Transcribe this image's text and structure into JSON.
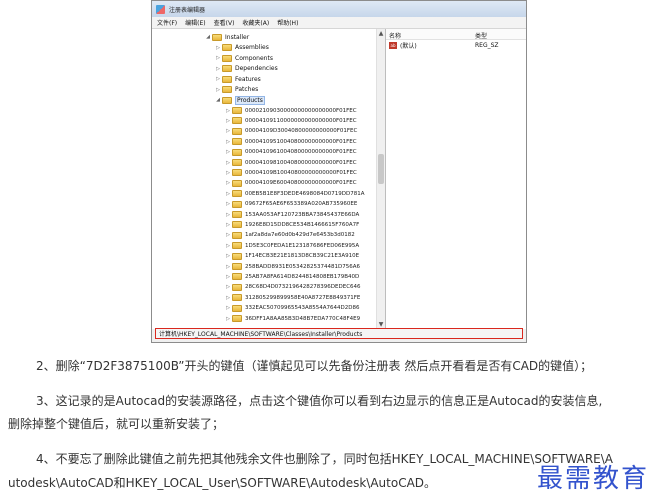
{
  "window": {
    "title": "注册表编辑器"
  },
  "menu": [
    "文件(F)",
    "编辑(E)",
    "查看(V)",
    "收藏夹(A)",
    "帮助(H)"
  ],
  "tree": {
    "items": [
      {
        "label": "Installer",
        "toggle": "◢",
        "selected": false
      },
      {
        "label": "Assemblies",
        "toggle": "▷",
        "selected": false
      },
      {
        "label": "Components",
        "toggle": "▷",
        "selected": false
      },
      {
        "label": "Dependencies",
        "toggle": "▷",
        "selected": false
      },
      {
        "label": "Features",
        "toggle": "▷",
        "selected": false
      },
      {
        "label": "Patches",
        "toggle": "▷",
        "selected": false
      },
      {
        "label": "Products",
        "toggle": "◢",
        "selected": true
      }
    ],
    "product_keys": [
      "00002109030000000000000000F01FEC",
      "00004109110000000000000000F01FEC",
      "00004109D30040800000000000F01FEC",
      "00004109510040800000000000F01FEC",
      "00004109610040800000000000F01FEC",
      "00004109810040800000000000F01FEC",
      "00004109B10040800000000000F01FEC",
      "00004109E60040800000000000F01FEC",
      "00EB5B1E8F3DEDE4698084D0719DD781A",
      "09672F65AE6F653389A020AB735960EE",
      "153AA053AF120723BBA73845437E66DA",
      "1926E8D15DD8CE534B1466615F760A7F",
      "1af2a8da7e60d0b429d7e6453b3d0182",
      "1D5E3C0FEDA1E123187686FED06E995A",
      "1F14ECB3E21E1813D8CB39C21E3A910E",
      "258BADD8931E05342825374481D756A6",
      "25AB7A8FA614D8244814808EB179B40D",
      "28C68D4D0732196428278396DEDEC646",
      "312805299899958E40A8727E8849371FE",
      "332EAC50709965543A8554A7644D2D86",
      "36DFF1A8AA85B3D48B7EDA770C48F4E9"
    ]
  },
  "values": {
    "col_name": "名称",
    "col_type": "类型",
    "rows": [
      {
        "name": "(默认)",
        "type": "REG_SZ",
        "icon": "string-value-icon"
      }
    ]
  },
  "statusbar": {
    "path": "计算机\\HKEY_LOCAL_MACHINE\\SOFTWARE\\Classes\\Installer\\Products"
  },
  "article": {
    "step2": "2、删除“7D2F3875100B”开头的键值（谨慎起见可以先备份注册表 然后点开看看是否有CAD的键值）；",
    "step3a": "3、这记录的是Autocad的安装源路径，点击这个键值你可以看到右边显示的信息正是Autocad的安装信息,",
    "step3b": "删除掉整个键值后，就可以重新安装了；",
    "step4a": "4、不要忘了删除此键值之前先把其他残余文件也删除了，同时包括HKEY_LOCAL_MACHINE\\SOFTWARE\\A",
    "step4b": "utodesk\\AutoCAD和HKEY_LOCAL_User\\SOFTWARE\\Autodesk\\AutoCAD。"
  },
  "watermark": "最需教育"
}
